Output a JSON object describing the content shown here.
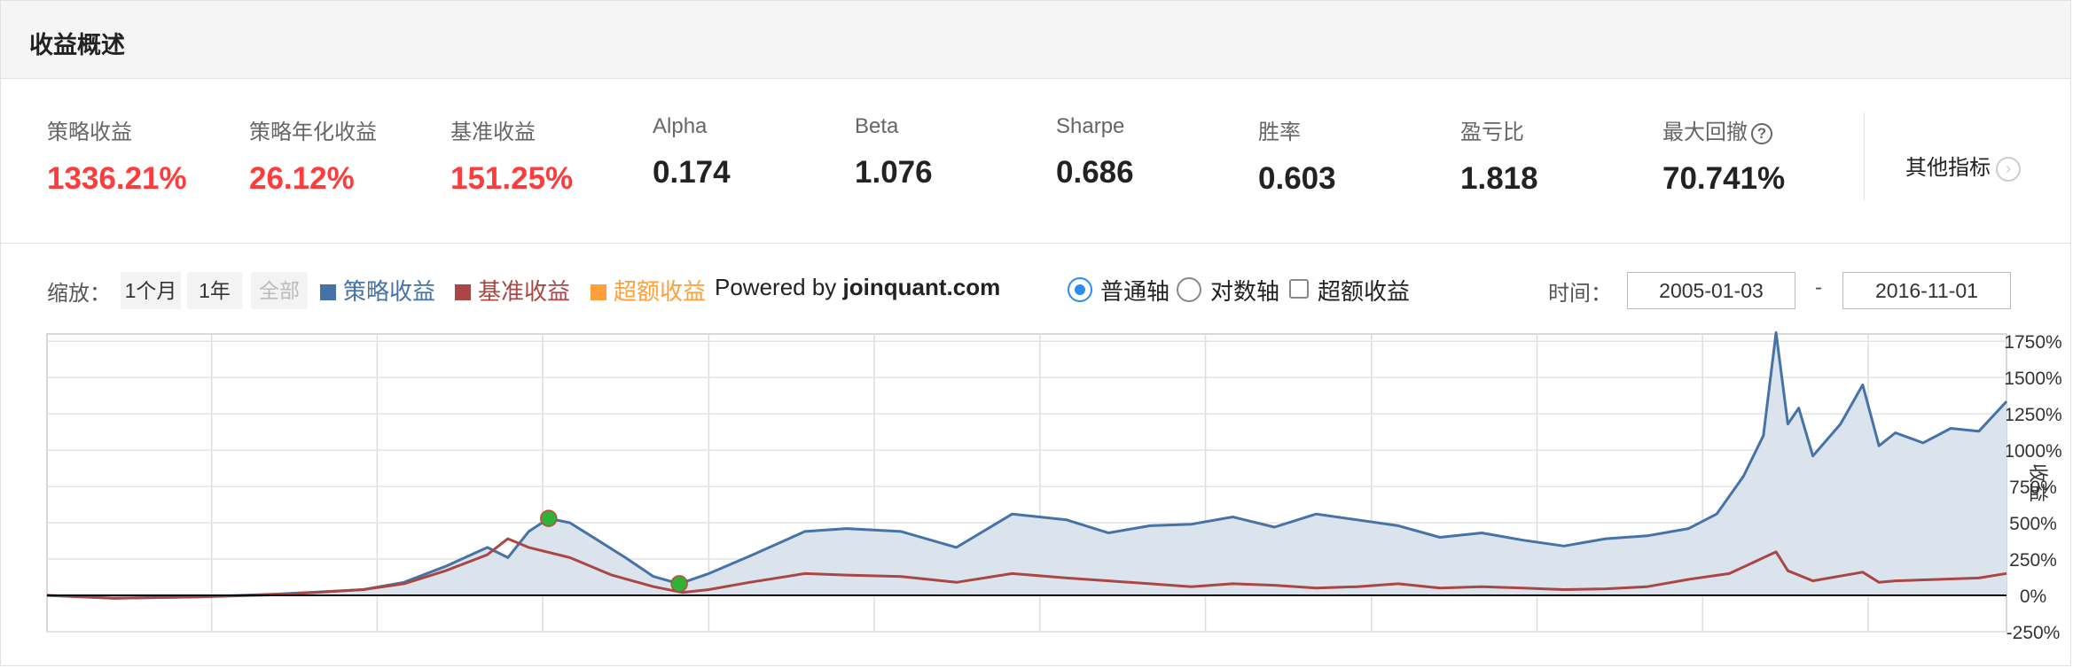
{
  "header": {
    "title": "收益概述"
  },
  "metrics": [
    {
      "label": "策略收益",
      "value": "1336.21%",
      "color": "#ff3b3b"
    },
    {
      "label": "策略年化收益",
      "value": "26.12%",
      "color": "#ff3b3b"
    },
    {
      "label": "基准收益",
      "value": "151.25%",
      "color": "#ff3b3b"
    },
    {
      "label": "Alpha",
      "value": "0.174"
    },
    {
      "label": "Beta",
      "value": "1.076"
    },
    {
      "label": "Sharpe",
      "value": "0.686"
    },
    {
      "label": "胜率",
      "value": "0.603"
    },
    {
      "label": "盈亏比",
      "value": "1.818"
    },
    {
      "label": "最大回撤",
      "value": "70.741%",
      "help_icon": "question-circle-icon"
    }
  ],
  "other_metrics": {
    "label": "其他指标",
    "icon": "chevron-right-icon"
  },
  "toolbar": {
    "zoom_label": "缩放：",
    "zoom_buttons": [
      {
        "label": "1个月",
        "disabled": false
      },
      {
        "label": "1年",
        "disabled": false
      },
      {
        "label": "全部",
        "disabled": true
      }
    ],
    "legend": [
      {
        "label": "策略收益",
        "color": "#4572a7"
      },
      {
        "label": "基准收益",
        "color": "#aa4643"
      },
      {
        "label": "超额收益",
        "color": "#ff9f3a"
      }
    ],
    "powered_prefix": "Powered by",
    "powered_site": "joinquant.com",
    "axis_options": [
      {
        "label": "普通轴",
        "selected": true
      },
      {
        "label": "对数轴",
        "selected": false
      }
    ],
    "excess_checkbox": {
      "label": "超额收益",
      "checked": false
    },
    "time_label": "时间：",
    "date_start": "2005-01-03",
    "date_sep": "-",
    "date_end": "2016-11-01"
  },
  "chart_data": {
    "type": "area",
    "ylabel": "收益",
    "ylim": [
      -250,
      1800
    ],
    "yticks": [
      -250,
      0,
      250,
      500,
      750,
      1000,
      1250,
      1500,
      1750
    ],
    "ytick_labels": [
      "-250%",
      "0%",
      "250%",
      "500%",
      "750%",
      "1000%",
      "1250%",
      "1500%",
      "1750%"
    ],
    "x_start": "2005-01-03",
    "x_end": "2016-11-01",
    "grid": true,
    "series": [
      {
        "name": "策略收益",
        "color": "#4572a7",
        "fill": "#d9e1ec",
        "points": [
          [
            "2005-01-03",
            0
          ],
          [
            "2005-06-01",
            -20
          ],
          [
            "2005-12-01",
            -10
          ],
          [
            "2006-06-01",
            10
          ],
          [
            "2006-12-01",
            40
          ],
          [
            "2007-03-01",
            90
          ],
          [
            "2007-06-01",
            200
          ],
          [
            "2007-09-01",
            330
          ],
          [
            "2007-10-16",
            260
          ],
          [
            "2007-12-01",
            440
          ],
          [
            "2008-01-14",
            530
          ],
          [
            "2008-03-01",
            500
          ],
          [
            "2008-05-01",
            380
          ],
          [
            "2008-07-01",
            260
          ],
          [
            "2008-09-01",
            130
          ],
          [
            "2008-10-28",
            80
          ],
          [
            "2009-01-01",
            150
          ],
          [
            "2009-04-01",
            270
          ],
          [
            "2009-08-01",
            440
          ],
          [
            "2009-11-01",
            460
          ],
          [
            "2010-03-01",
            440
          ],
          [
            "2010-07-01",
            330
          ],
          [
            "2010-11-01",
            560
          ],
          [
            "2011-03-01",
            520
          ],
          [
            "2011-06-01",
            430
          ],
          [
            "2011-09-01",
            480
          ],
          [
            "2011-12-01",
            490
          ],
          [
            "2012-03-01",
            540
          ],
          [
            "2012-06-01",
            470
          ],
          [
            "2012-09-01",
            560
          ],
          [
            "2012-12-01",
            520
          ],
          [
            "2013-03-01",
            480
          ],
          [
            "2013-06-01",
            400
          ],
          [
            "2013-09-01",
            430
          ],
          [
            "2013-12-01",
            380
          ],
          [
            "2014-03-01",
            340
          ],
          [
            "2014-06-01",
            390
          ],
          [
            "2014-09-01",
            410
          ],
          [
            "2014-12-01",
            460
          ],
          [
            "2015-02-01",
            560
          ],
          [
            "2015-04-01",
            820
          ],
          [
            "2015-05-15",
            1100
          ],
          [
            "2015-06-12",
            1810
          ],
          [
            "2015-07-08",
            1180
          ],
          [
            "2015-08-01",
            1290
          ],
          [
            "2015-09-01",
            960
          ],
          [
            "2015-11-01",
            1180
          ],
          [
            "2015-12-20",
            1450
          ],
          [
            "2016-01-25",
            1030
          ],
          [
            "2016-03-01",
            1120
          ],
          [
            "2016-05-01",
            1050
          ],
          [
            "2016-07-01",
            1150
          ],
          [
            "2016-09-01",
            1130
          ],
          [
            "2016-11-01",
            1336
          ]
        ]
      },
      {
        "name": "基准收益",
        "color": "#aa4643",
        "points": [
          [
            "2005-01-03",
            0
          ],
          [
            "2005-06-01",
            -20
          ],
          [
            "2005-12-01",
            -10
          ],
          [
            "2006-06-01",
            5
          ],
          [
            "2006-12-01",
            40
          ],
          [
            "2007-03-01",
            80
          ],
          [
            "2007-06-01",
            170
          ],
          [
            "2007-09-01",
            280
          ],
          [
            "2007-10-16",
            390
          ],
          [
            "2007-12-01",
            330
          ],
          [
            "2008-03-01",
            260
          ],
          [
            "2008-06-01",
            140
          ],
          [
            "2008-09-01",
            60
          ],
          [
            "2008-11-04",
            20
          ],
          [
            "2009-01-01",
            40
          ],
          [
            "2009-04-01",
            90
          ],
          [
            "2009-08-01",
            150
          ],
          [
            "2009-11-01",
            140
          ],
          [
            "2010-03-01",
            130
          ],
          [
            "2010-07-01",
            90
          ],
          [
            "2010-11-01",
            150
          ],
          [
            "2011-03-01",
            120
          ],
          [
            "2011-06-01",
            100
          ],
          [
            "2011-09-01",
            80
          ],
          [
            "2011-12-01",
            60
          ],
          [
            "2012-03-01",
            80
          ],
          [
            "2012-06-01",
            70
          ],
          [
            "2012-09-01",
            50
          ],
          [
            "2012-12-01",
            60
          ],
          [
            "2013-03-01",
            80
          ],
          [
            "2013-06-01",
            50
          ],
          [
            "2013-09-01",
            60
          ],
          [
            "2013-12-01",
            50
          ],
          [
            "2014-03-01",
            40
          ],
          [
            "2014-06-01",
            45
          ],
          [
            "2014-09-01",
            60
          ],
          [
            "2014-12-01",
            110
          ],
          [
            "2015-03-01",
            150
          ],
          [
            "2015-06-12",
            300
          ],
          [
            "2015-07-08",
            170
          ],
          [
            "2015-09-01",
            100
          ],
          [
            "2015-12-20",
            160
          ],
          [
            "2016-01-25",
            90
          ],
          [
            "2016-03-01",
            100
          ],
          [
            "2016-06-01",
            110
          ],
          [
            "2016-09-01",
            120
          ],
          [
            "2016-11-01",
            151
          ]
        ]
      }
    ],
    "markers": [
      {
        "date": "2008-01-14",
        "value": 530,
        "color": "#2fb336"
      },
      {
        "date": "2008-10-28",
        "value": 80,
        "color": "#2fb336"
      }
    ]
  }
}
